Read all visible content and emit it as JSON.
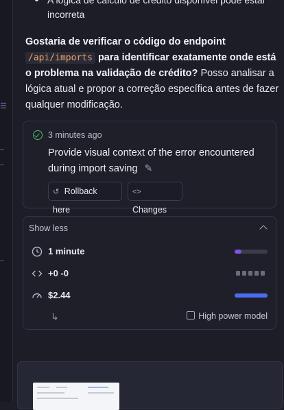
{
  "previous": {
    "bullet_line1": "A lógica de cálculo de crédito disponível pode estar",
    "bullet_line2": "incorreta"
  },
  "message": {
    "bold_prefix": "Gostaria de verificar o código do endpoint",
    "code": "/api/imports",
    "bold_suffix": "para identificar exatamente onde está o problema na validação de crédito?",
    "rest": "Posso analisar a lógica atual e propor a correção específica antes de fazer qualquer modificação."
  },
  "task": {
    "time": "3 minutes ago",
    "title": "Provide visual context of the error encountered during import saving",
    "rollback_label": "Rollback here",
    "changes_label": "Changes"
  },
  "stats": {
    "toggle_label": "Show less",
    "duration": "1 minute",
    "duration_fraction": 0.2,
    "diff": "+0 -0",
    "cost": "$2.44",
    "cost_fraction": 1.0,
    "mode_label": "High power model"
  },
  "icons": {
    "check": "check-circle-icon",
    "pencil": "pencil-icon",
    "rollback": "rollback-icon",
    "changes": "code-icon",
    "clock": "clock-icon",
    "diff": "code-icon",
    "gauge": "gauge-icon",
    "reply": "reply-arrow-icon",
    "chip": "chip-icon"
  },
  "colors": {
    "success": "#4bbd6b",
    "accent_purple": "#7a55e6",
    "accent_blue": "#4a6cf0",
    "code_text": "#f0a36a"
  }
}
